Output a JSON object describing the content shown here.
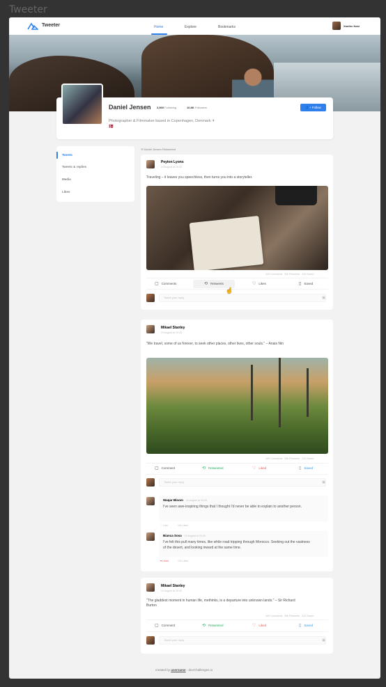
{
  "window_title": "Tweeter",
  "nav": {
    "brand": "Tweeter",
    "items": [
      "Home",
      "Explore",
      "Bookmarks"
    ],
    "active": "Home",
    "user_name": "Xanthe Neal"
  },
  "profile": {
    "name": "Daniel Jensen",
    "following_count": "2,569",
    "following_label": "Following",
    "followers_count": "10.8K",
    "followers_label": "Followers",
    "bio": "Photographer & Filmmaker based in Copenhagen, Denmark ✈ 🇩🇰",
    "follow_button": "Follow",
    "follow_icon": "person-add-icon"
  },
  "sidebar": {
    "items": [
      "Tweets",
      "Tweets & replies",
      "Media",
      "Likes"
    ],
    "active": "Tweets"
  },
  "retweet_note": "Daniel Jensen Retweeted",
  "tweets": [
    {
      "author": "Peyton Lyons",
      "date": "24 August at 20:43",
      "text": "Traveling – it leaves you speechless, then turns you into a storyteller.",
      "stats": {
        "comments": "449 Comments",
        "retweets": "59k Retweets",
        "saved": "234 Saved"
      },
      "actions": {
        "comment": "Comments",
        "retweet": "Retweets",
        "like": "Likes",
        "save": "Saved"
      },
      "reply_placeholder": "Tweet your reply"
    },
    {
      "author": "Mikael Stanley",
      "date": "24 August at 20:43",
      "text": "\"We travel, some of us forever, to seek other places, other lives, other souls.\" – Anais Nin",
      "stats": {
        "comments": "449 Comments",
        "retweets": "59k Retweets",
        "saved": "234 Saved"
      },
      "actions": {
        "comment": "Comment",
        "retweet": "Retweeted",
        "like": "Liked",
        "save": "Saved"
      },
      "reply_placeholder": "Tweet your reply",
      "comments": [
        {
          "author": "Waqar Bloom",
          "date": "24 August at 20:43",
          "text": "I've seen awe-inspiring things that I thought I'd never be able to explain to another person.",
          "like_label": "Like",
          "likes": "12k Likes"
        },
        {
          "author": "Bianca Sosa",
          "date": "24 August at 20:43",
          "text": "I've felt this pull many times, like while road tripping through Morocco. Seeking out the vastness of the desert, and looking inward at the same time.",
          "like_label": "Liked",
          "likes": "12k Likes"
        }
      ]
    },
    {
      "author": "Mikael Stanley",
      "date": "24 August at 20:43",
      "text": "\"The gladdest moment in human life, methinks, is a departure into unknown lands.\" – Sir Richard Burton",
      "stats": {
        "comments": "449 Comments",
        "retweets": "59k Retweets",
        "saved": "234 Saved"
      },
      "actions": {
        "comment": "Comment",
        "retweet": "Retweeted",
        "like": "Liked",
        "save": "Saved"
      },
      "reply_placeholder": "Tweet your reply"
    }
  ],
  "footer": {
    "prefix": "created by",
    "username": "username",
    "suffix": "- devChallenges.io"
  },
  "colors": {
    "accent": "#2f80ed",
    "retweeted": "#27ae60",
    "liked": "#eb5757",
    "saved": "#2d9cdb"
  }
}
